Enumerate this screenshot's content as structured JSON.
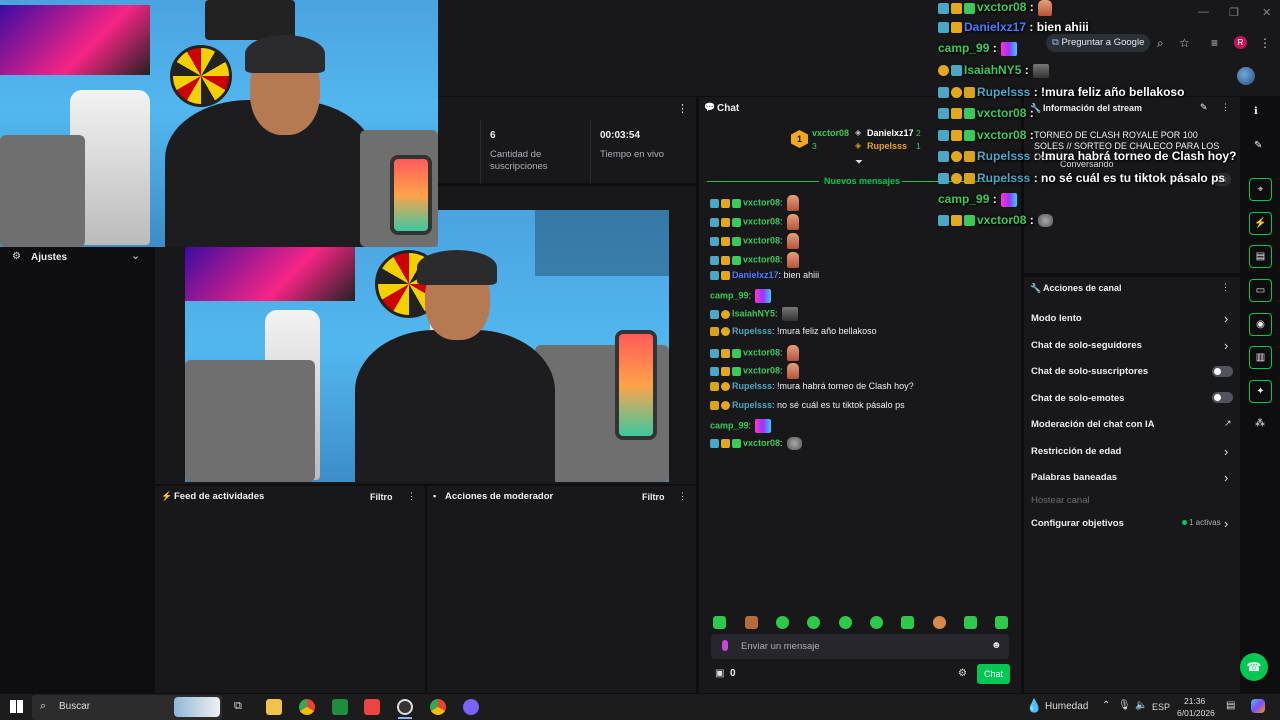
{
  "browser": {
    "ask_google": "Preguntar a Google",
    "avatar_letter": "R"
  },
  "stats": [
    {
      "value": "6",
      "label": "Cantidad de suscripciones"
    },
    {
      "value": "00:03:54",
      "label": "Tiempo en vivo"
    }
  ],
  "sidebar": {
    "settings_label": "Ajustes"
  },
  "chat": {
    "title": "Chat",
    "leaderboard": [
      {
        "rank": "1",
        "name": "vxctor08",
        "count": "3"
      },
      {
        "name": "Danielxz17",
        "count": "2"
      },
      {
        "name": "Rupelsss",
        "count": "1"
      }
    ],
    "new_messages": "Nuevos mensajes",
    "messages": [
      {
        "user": "vxctor08",
        "text": "",
        "color": "#3cc95b"
      },
      {
        "user": "vxctor08",
        "text": "",
        "color": "#3cc95b"
      },
      {
        "user": "vxctor08",
        "text": "",
        "color": "#3cc95b"
      },
      {
        "user": "vxctor08",
        "text": "",
        "color": "#3cc95b"
      },
      {
        "user": "Danielxz17",
        "text": "bien ahiii",
        "color": "#4a7cff"
      },
      {
        "user": "camp_99",
        "text": "",
        "color": "#3cc95b"
      },
      {
        "user": "IsaiahNY5",
        "text": "",
        "color": "#3cc95b"
      },
      {
        "user": "Rupelsss",
        "text": "!mura feliz año bellakoso",
        "color": "#4aa7c5"
      },
      {
        "user": "vxctor08",
        "text": "",
        "color": "#3cc95b"
      },
      {
        "user": "vxctor08",
        "text": "",
        "color": "#3cc95b"
      },
      {
        "user": "Rupelsss",
        "text": "!mura habrá torneo de Clash hoy?",
        "color": "#4aa7c5"
      },
      {
        "user": "Rupelsss",
        "text": "no sé cuál es tu tiktok pásalo ps",
        "color": "#4aa7c5"
      },
      {
        "user": "camp_99",
        "text": "",
        "color": "#3cc95b"
      },
      {
        "user": "vxctor08",
        "text": "",
        "color": "#3cc95b"
      }
    ],
    "input_placeholder": "Enviar un mensaje",
    "points": "0",
    "send_label": "Chat"
  },
  "overlay_chat": [
    {
      "user": "vxctor08",
      "sep": ":",
      "text": ""
    },
    {
      "user": "Danielxz17",
      "sep": ":",
      "text": "bien ahiii"
    },
    {
      "user": "camp_99",
      "sep": ":",
      "text": ""
    },
    {
      "user": "IsaiahNY5",
      "sep": ":",
      "text": ""
    },
    {
      "user": "Rupelsss",
      "sep": ":",
      "text": "!mura feliz año bellakoso"
    },
    {
      "user": "vxctor08",
      "sep": ":",
      "text": ""
    },
    {
      "user": "vxctor08",
      "sep": ":",
      "text": ""
    },
    {
      "user": "Rupelsss",
      "sep": ":",
      "text": "!mura habrá torneo de Clash hoy?"
    },
    {
      "user": "Rupelsss",
      "sep": ":",
      "text": "no sé cuál es tu tiktok pásalo ps"
    },
    {
      "user": "camp_99",
      "sep": ":",
      "text": ""
    },
    {
      "user": "vxctor08",
      "sep": ":",
      "text": ""
    }
  ],
  "stream_info": {
    "title": "Información del stream",
    "stream_title": "TORNEO DE CLASH ROYALE POR 100 SOLES // SORTEO DE CHALECO PARA LOS OGS",
    "category": "Conversando",
    "tag": "Ju"
  },
  "channel_actions": {
    "title": "Acciones de canal",
    "items": [
      {
        "label": "Modo lento",
        "control": "chevron"
      },
      {
        "label": "Chat de solo-seguidores",
        "control": "chevron"
      },
      {
        "label": "Chat de solo-suscriptores",
        "control": "toggle"
      },
      {
        "label": "Chat de solo-emotes",
        "control": "toggle"
      },
      {
        "label": "Moderación del chat con IA",
        "control": "external"
      },
      {
        "label": "Restricción de edad",
        "control": "chevron"
      },
      {
        "label": "Palabras baneadas",
        "control": "chevron"
      },
      {
        "label": "Hostear canal",
        "control": "none"
      },
      {
        "label": "Configurar objetivos",
        "control": "chevron"
      }
    ],
    "goals_status": "1 activas"
  },
  "activity_feed": {
    "title": "Feed de actividades",
    "filter": "Filtro"
  },
  "mod_actions": {
    "title": "Acciones de moderador",
    "filter": "Filtro"
  },
  "taskbar": {
    "search": "Buscar",
    "weather": "Humedad",
    "lang": "ESP",
    "time": "21:36",
    "date": "6/01/2026"
  },
  "colors": {
    "accent": "#00c853",
    "background": "#0e0e10",
    "panel": "#18181b"
  }
}
